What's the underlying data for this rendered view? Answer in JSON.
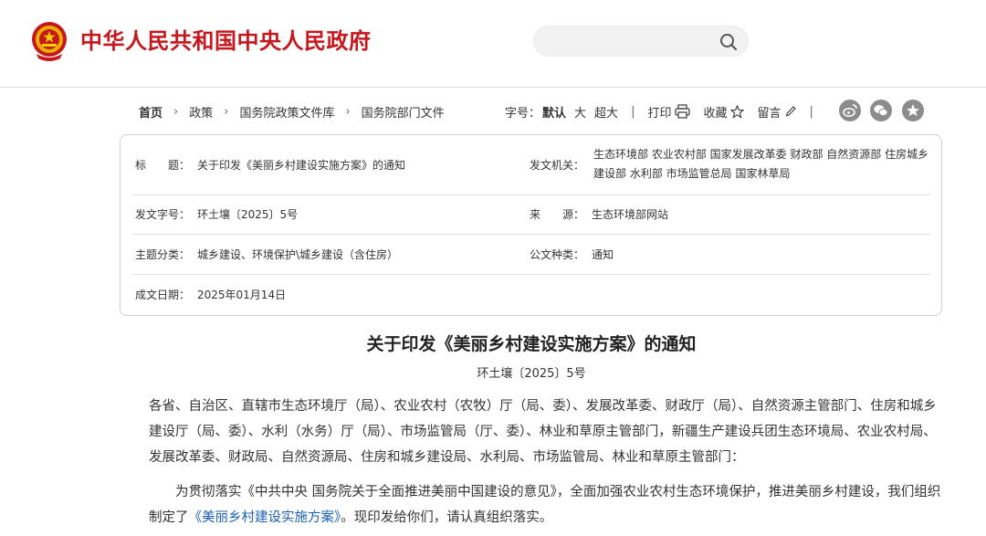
{
  "header": {
    "site_title": "中华人民共和国中央人民政府",
    "search_value": ""
  },
  "breadcrumb": {
    "items": [
      "首页",
      "政策",
      "国务院政策文件库",
      "国务院部门文件"
    ]
  },
  "toolbar": {
    "font_size_label": "字号：",
    "font_default": "默认",
    "font_large": "大",
    "font_xlarge": "超大",
    "print_label": "打印",
    "favorite_label": "收藏",
    "comment_label": "留言"
  },
  "info": {
    "title_label": "标　　题：",
    "title_value": "关于印发《美丽乡村建设实施方案》的通知",
    "issuer_label": "发文机关：",
    "issuer_value": "生态环境部 农业农村部 国家发展改革委 财政部 自然资源部 住房城乡建设部 水利部 市场监管总局 国家林草局",
    "docno_label": "发文字号：",
    "docno_value": "环土壤〔2025〕5号",
    "source_label": "来　　源：",
    "source_value": "生态环境部网站",
    "category_label": "主题分类：",
    "category_value": "城乡建设、环境保护\\城乡建设（含住房）",
    "type_label": "公文种类：",
    "type_value": "通知",
    "date_label": "成文日期：",
    "date_value": "2025年01月14日"
  },
  "article": {
    "title": "关于印发《美丽乡村建设实施方案》的通知",
    "doc_no": "环土壤〔2025〕5号",
    "recipients": "各省、自治区、直辖市生态环境厅（局）、农业农村（农牧）厅（局、委）、发展改革委、财政厅（局）、自然资源主管部门、住房和城乡建设厅（局、委）、水利（水务）厅（局）、市场监管局（厅、委）、林业和草原主管部门，新疆生产建设兵团生态环境局、农业农村局、发展改革委、财政局、自然资源局、住房和城乡建设局、水利局、市场监管局、林业和草原主管部门：",
    "body_part1": "　　为贯彻落实《中共中央 国务院关于全面推进美丽中国建设的意见》，全面加强农业农村生态环境保护，推进美丽乡村建设，我们组织制定了",
    "body_link": "《美丽乡村建设实施方案》",
    "body_part2": "。现印发给你们，请认真组织落实。"
  },
  "colors": {
    "brand_red": "#c8161d",
    "link_blue": "#1a5fb4",
    "share_gray": "#8c8c8c"
  }
}
